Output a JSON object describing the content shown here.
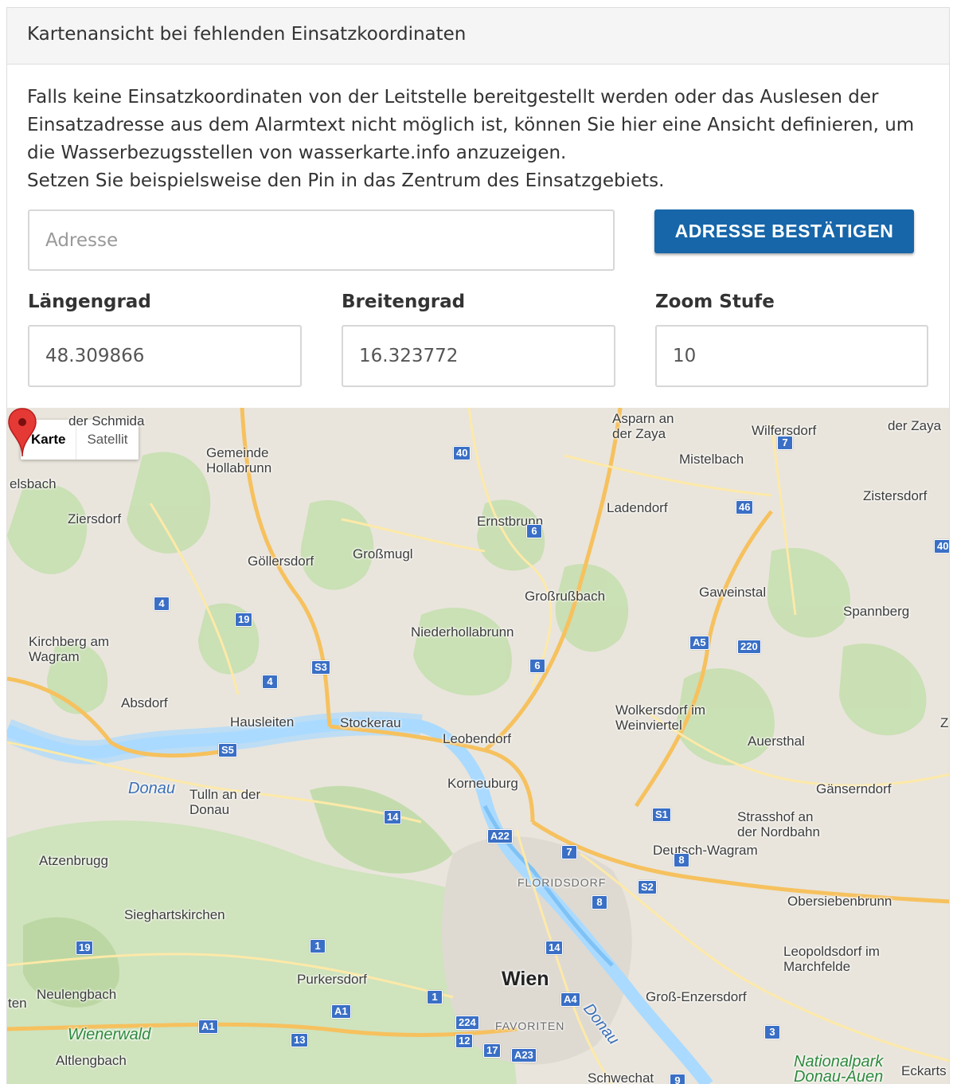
{
  "panel": {
    "title": "Kartenansicht bei fehlenden Einsatzkoordinaten",
    "intro_line1": "Falls keine Einsatzkoordinaten von der Leitstelle bereitgestellt werden oder das Auslesen der Einsatzadresse aus dem Alarmtext nicht möglich ist, können Sie hier eine Ansicht definieren, um die Wasserbezugsstellen von wasserkarte.info anzuzeigen.",
    "intro_line2": "Setzen Sie beispielsweise den Pin in das Zentrum des Einsatzgebiets."
  },
  "address": {
    "placeholder": "Adresse",
    "value": ""
  },
  "confirm_button": "ADRESSE BESTÄTIGEN",
  "fields": {
    "longitude": {
      "label": "Längengrad",
      "value": "48.309866"
    },
    "latitude": {
      "label": "Breitengrad",
      "value": "16.323772"
    },
    "zoom": {
      "label": "Zoom Stufe",
      "value": "10"
    }
  },
  "map": {
    "type_control": {
      "map": "Karte",
      "satellite": "Satellit"
    },
    "places": [
      "der Schmida",
      "Gemeinde Hollabrunn",
      "elsbach",
      "Ziersdorf",
      "Göllersdorf",
      "Großmugl",
      "Ernstbrunn",
      "Asparn an der Zaya",
      "Wilfersdorf",
      "der Zaya",
      "Mistelbach",
      "Ladendorf",
      "Zistersdorf",
      "Großrußbach",
      "Gaweinstal",
      "Spannberg",
      "Niederhollabrunn",
      "Kirchberg am Wagram",
      "Absdorf",
      "Hausleiten",
      "Stockerau",
      "Leobendorf",
      "Wolkersdorf im Weinviertel",
      "Auersthal",
      "Z",
      "Donau",
      "Tulln an der Donau",
      "Korneuburg",
      "Gänserndorf",
      "Strasshof an der Nordbahn",
      "Deutsch-Wagram",
      "Atzenbrugg",
      "FLORIDSDORF",
      "Obersiebenbrunn",
      "Sieghartskirchen",
      "Leopoldsdorf im Marchfelde",
      "Purkersdorf",
      "Wien",
      "ten",
      "Neulengbach",
      "Groß-Enzersdorf",
      "Wienerwald",
      "FAVORITEN",
      "Donau",
      "Altlengbach",
      "Nationalpark Donau-Auen",
      "Eckarts",
      "Schwechat"
    ],
    "shields": [
      "40",
      "7",
      "46",
      "40",
      "6",
      "4",
      "19",
      "A5",
      "220",
      "S3",
      "4",
      "6",
      "S5",
      "14",
      "S1",
      "A22",
      "7",
      "8",
      "S2",
      "8",
      "19",
      "1",
      "14",
      "1",
      "A4",
      "A1",
      "A1",
      "224",
      "13",
      "12",
      "17",
      "A23",
      "3",
      "9"
    ]
  }
}
